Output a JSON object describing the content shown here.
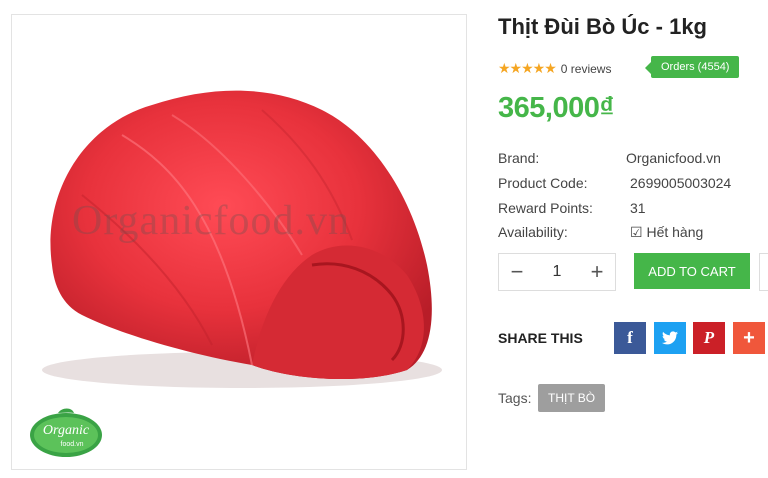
{
  "product": {
    "title": "Thịt Đùi Bò Úc - 1kg",
    "stars": "★★★★★",
    "reviews": "0 reviews",
    "orders": "Orders (4554)",
    "price": "365,000₫",
    "watermark": "Organicfood.vn",
    "logo_text": "Organic food.vn"
  },
  "info": [
    {
      "label": "Brand:",
      "value": "Organicfood.vn"
    },
    {
      "label": "Product Code:",
      "value": "2699005003024"
    },
    {
      "label": "Reward Points:",
      "value": "31"
    },
    {
      "label": "Availability:",
      "value": "Hết hàng"
    }
  ],
  "quantity": {
    "minus": "−",
    "value": "1",
    "plus": "+"
  },
  "cart": {
    "add_label": "ADD TO CART"
  },
  "share": {
    "label": "SHARE THIS",
    "facebook": "f",
    "pinterest": "P",
    "more": "+"
  },
  "tags": {
    "label": "Tags:",
    "items": [
      "THỊT BÒ"
    ]
  },
  "colors": {
    "brand_green": "#45b649",
    "facebook": "#3b5998",
    "twitter": "#1da1f2",
    "pinterest": "#cb2027",
    "more": "#f0573b"
  }
}
